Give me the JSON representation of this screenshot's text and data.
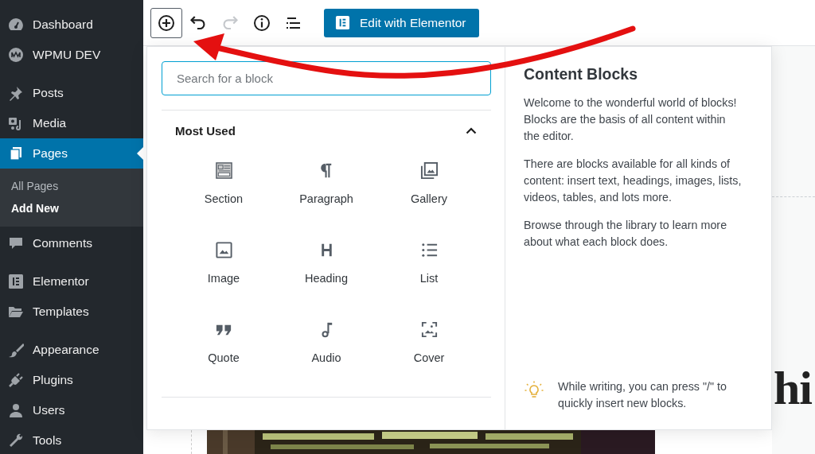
{
  "sidebar": {
    "groups": [
      {
        "items": [
          {
            "label": "Dashboard",
            "selected": false
          },
          {
            "label": "WPMU DEV",
            "selected": false
          }
        ]
      },
      {
        "items": [
          {
            "label": "Posts",
            "selected": false
          },
          {
            "label": "Media",
            "selected": false
          },
          {
            "label": "Pages",
            "selected": true,
            "submenu": [
              {
                "label": "All Pages",
                "selected": false
              },
              {
                "label": "Add New",
                "selected": true
              }
            ]
          },
          {
            "label": "Comments",
            "selected": false
          }
        ]
      },
      {
        "items": [
          {
            "label": "Elementor",
            "selected": false
          },
          {
            "label": "Templates",
            "selected": false
          }
        ]
      },
      {
        "items": [
          {
            "label": "Appearance",
            "selected": false
          },
          {
            "label": "Plugins",
            "selected": false
          },
          {
            "label": "Users",
            "selected": false
          },
          {
            "label": "Tools",
            "selected": false
          }
        ]
      }
    ]
  },
  "toolbar": {
    "tools": [
      {
        "kind": "add",
        "active": true,
        "disabled": false
      },
      {
        "kind": "undo",
        "active": false,
        "disabled": false
      },
      {
        "kind": "redo",
        "active": false,
        "disabled": true
      },
      {
        "kind": "info",
        "active": false,
        "disabled": false
      },
      {
        "kind": "outline",
        "active": false,
        "disabled": false
      }
    ],
    "elementor_button": "Edit with Elementor"
  },
  "inserter": {
    "search": {
      "placeholder": "Search for a block"
    },
    "section": {
      "title": "Most Used",
      "expanded": true,
      "blocks": [
        {
          "label": "Section"
        },
        {
          "label": "Paragraph"
        },
        {
          "label": "Gallery"
        },
        {
          "label": "Image"
        },
        {
          "label": "Heading"
        },
        {
          "label": "List"
        },
        {
          "label": "Quote"
        },
        {
          "label": "Audio"
        },
        {
          "label": "Cover"
        }
      ]
    },
    "help": {
      "title": "Content Blocks",
      "paragraphs": [
        "Welcome to the wonderful world of blocks! Blocks are the basis of all content within the editor.",
        "There are blocks available for all kinds of content: insert text, headings, images, lists, videos, tables, and lots more.",
        "Browse through the library to learn more about what each block does."
      ],
      "tip": "While writing, you can press \"/\" to quickly insert new blocks."
    }
  },
  "editor": {
    "heading": "hi"
  }
}
